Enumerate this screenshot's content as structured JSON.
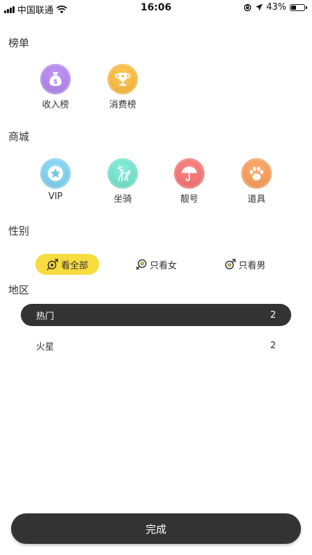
{
  "status_bar": {
    "carrier": "中国联通",
    "time": "16:06",
    "battery_percent": "43%",
    "battery_level": 0.43
  },
  "sections": {
    "ranking": {
      "title": "榜单",
      "items": [
        {
          "label": "收入榜",
          "icon": "money-bag-icon",
          "color": "#a97ee0"
        },
        {
          "label": "消费榜",
          "icon": "trophy-icon",
          "color": "#f2b13e"
        }
      ]
    },
    "mall": {
      "title": "商城",
      "items": [
        {
          "label": "VIP",
          "icon": "star-badge-icon",
          "color": "#79c6e4"
        },
        {
          "label": "坐骑",
          "icon": "deer-icon",
          "color": "#6fd7c4"
        },
        {
          "label": "靓号",
          "icon": "umbrella-icon",
          "color": "#ec6e6e"
        },
        {
          "label": "道具",
          "icon": "paw-icon",
          "color": "#ee9556"
        }
      ]
    },
    "gender": {
      "title": "性别",
      "options": [
        {
          "label": "看全部",
          "selected": true
        },
        {
          "label": "只看女",
          "selected": false
        },
        {
          "label": "只看男",
          "selected": false
        }
      ]
    },
    "region": {
      "title": "地区",
      "items": [
        {
          "label": "热门",
          "count": "2",
          "active": true
        },
        {
          "label": "火星",
          "count": "2",
          "active": false
        }
      ]
    }
  },
  "done_label": "完成",
  "colors": {
    "accent_yellow": "#f8dc3e",
    "dark": "#333333"
  }
}
